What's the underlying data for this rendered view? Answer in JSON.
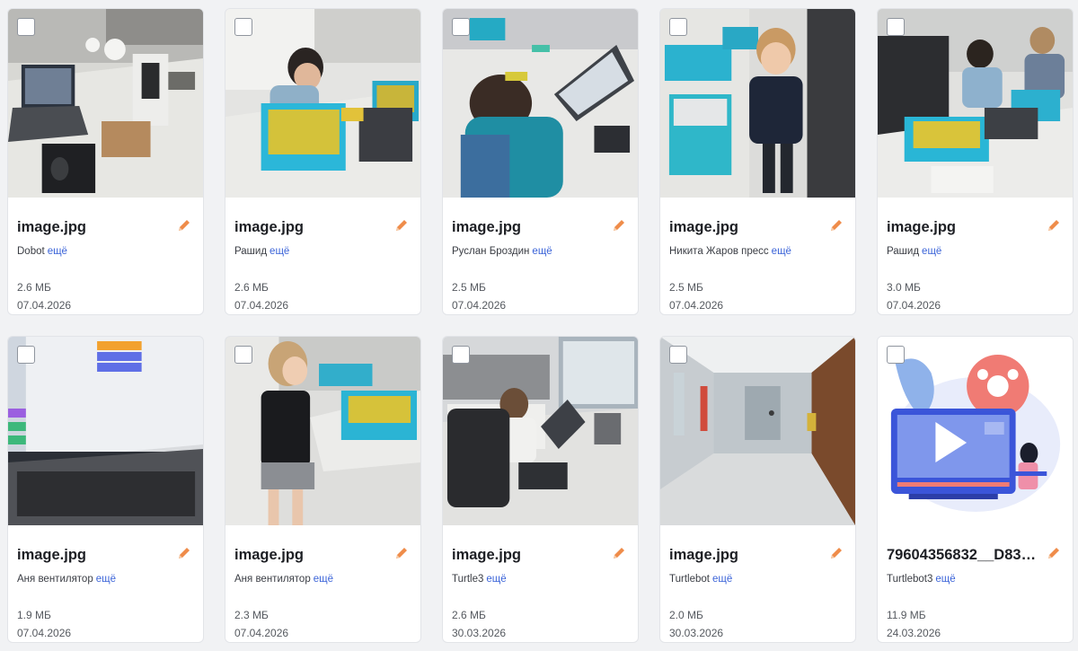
{
  "gallery": {
    "items": [
      {
        "name": "image.jpg",
        "description": "Dobot",
        "more": "ещё",
        "size": "2.6 МБ",
        "date": "07.04.2026",
        "thumb": "robot-desk",
        "edit_icon": "pencil-icon"
      },
      {
        "name": "image.jpg",
        "description": "Рашид",
        "more": "ещё",
        "size": "2.6 МБ",
        "date": "07.04.2026",
        "thumb": "boy-lego",
        "edit_icon": "pencil-icon"
      },
      {
        "name": "image.jpg",
        "description": "Руслан Броздин",
        "more": "ещё",
        "size": "2.5 МБ",
        "date": "07.04.2026",
        "thumb": "boy-laptop",
        "edit_icon": "pencil-icon"
      },
      {
        "name": "image.jpg",
        "description": "Никита Жаров пресс",
        "more": "ещё",
        "size": "2.5 МБ",
        "date": "07.04.2026",
        "thumb": "boy-standing",
        "edit_icon": "pencil-icon"
      },
      {
        "name": "image.jpg",
        "description": "Рашид",
        "more": "ещё",
        "size": "3.0 МБ",
        "date": "07.04.2026",
        "thumb": "boys-table",
        "edit_icon": "pencil-icon"
      },
      {
        "name": "image.jpg",
        "description": "Аня вентилятор",
        "more": "ещё",
        "size": "1.9 МБ",
        "date": "07.04.2026",
        "thumb": "laptop-scratch",
        "edit_icon": "pencil-icon"
      },
      {
        "name": "image.jpg",
        "description": "Аня вентилятор",
        "more": "ещё",
        "size": "2.3 МБ",
        "date": "07.04.2026",
        "thumb": "girl-lego",
        "edit_icon": "pencil-icon"
      },
      {
        "name": "image.jpg",
        "description": "Turtle3",
        "more": "ещё",
        "size": "2.6 МБ",
        "date": "30.03.2026",
        "thumb": "boy-chair",
        "edit_icon": "pencil-icon"
      },
      {
        "name": "image.jpg",
        "description": "Turtlebot",
        "more": "ещё",
        "size": "2.0 МБ",
        "date": "30.03.2026",
        "thumb": "corridor",
        "edit_icon": "pencil-icon"
      },
      {
        "name": "79604356832__D83…",
        "description": "Turtlebot3",
        "more": "ещё",
        "size": "11.9 МБ",
        "date": "24.03.2026",
        "thumb": "video-illustration",
        "edit_icon": "pencil-icon"
      }
    ]
  },
  "colors": {
    "link": "#3a63d8",
    "edit_icon": "#ef8c4a",
    "background": "#f1f2f4"
  }
}
